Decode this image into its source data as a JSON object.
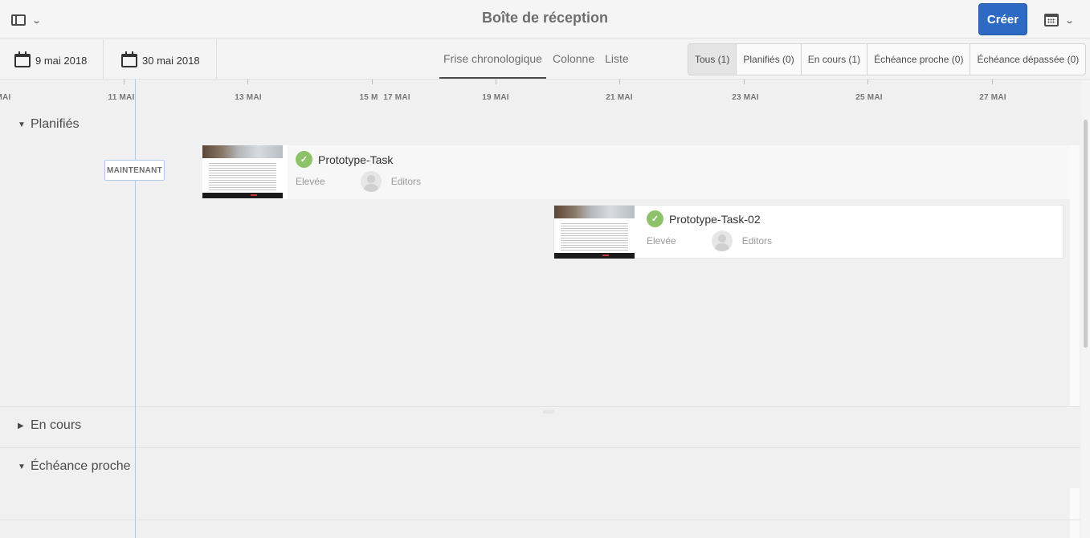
{
  "header": {
    "title": "Boîte de réception",
    "create_label": "Créer",
    "rail_icon": "side-panel-icon",
    "calendar_icon": "calendar-icon",
    "chevron_glyph": "⌄"
  },
  "toolbar": {
    "start_date": "9 mai 2018",
    "end_date": "30 mai 2018",
    "views": [
      "Frise chronologique",
      "Colonne",
      "Liste"
    ],
    "active_view": "Frise chronologique",
    "filters": [
      "Tous (1)",
      "Planifiés (0)",
      "En cours (1)",
      "Échéance proche (0)",
      "Échéance dépassée (0)"
    ],
    "active_filter": "Tous (1)"
  },
  "timeline": {
    "ticks": [
      "MAI",
      "11 MAI",
      "13 MAI",
      "15 M",
      "17 MAI",
      "19 MAI",
      "21 MAI",
      "23 MAI",
      "25 MAI",
      "27 MAI"
    ],
    "now_label": "MAINTENANT",
    "sections": [
      {
        "label": "Planifiés",
        "expanded": true
      },
      {
        "label": "En cours",
        "expanded": false
      },
      {
        "label": "Échéance proche",
        "expanded": true
      }
    ],
    "tasks": [
      {
        "title": "Prototype-Task",
        "priority": "Elevée",
        "assignee": "Editors",
        "status_color": "#8dc269"
      },
      {
        "title": "Prototype-Task-02",
        "priority": "Elevée",
        "assignee": "Editors",
        "status_color": "#8dc269"
      }
    ]
  },
  "colors": {
    "accent": "#2d6ac4",
    "now_line": "#aecbed",
    "status_green": "#8dc269"
  }
}
